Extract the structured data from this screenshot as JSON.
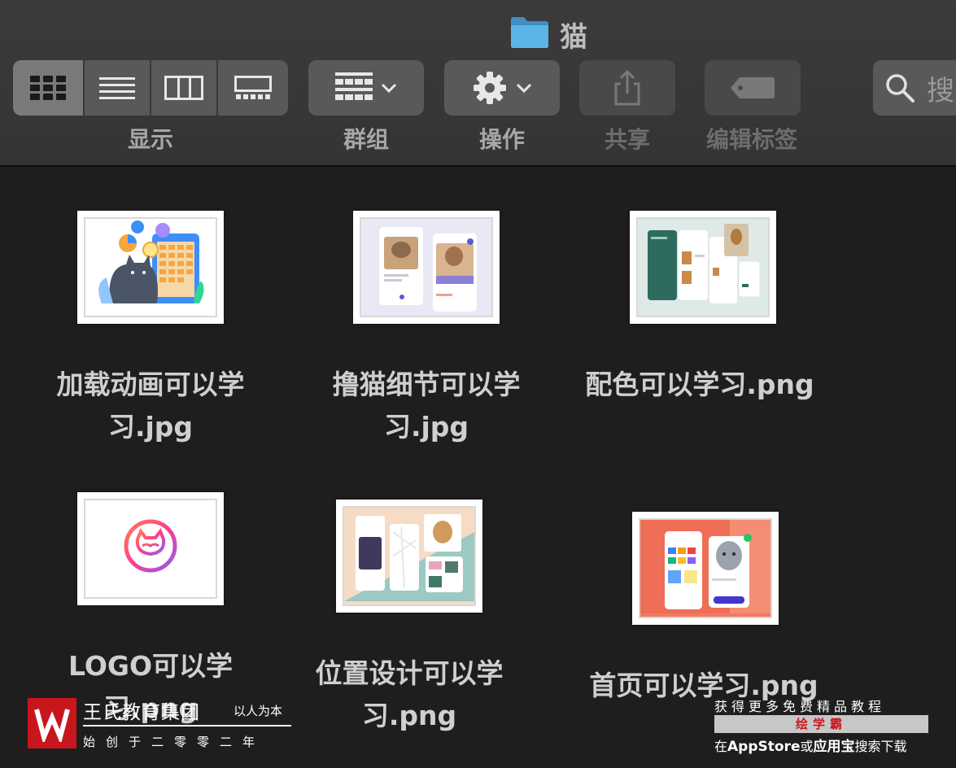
{
  "window": {
    "title": "猫"
  },
  "toolbar": {
    "view_label": "显示",
    "group_label": "群组",
    "action_label": "操作",
    "share_label": "共享",
    "tags_label": "编辑标签",
    "search_placeholder": "搜"
  },
  "files": [
    {
      "name_line1": "加载动画可以学",
      "name_line2": "习.jpg"
    },
    {
      "name_line1": "撸猫细节可以学",
      "name_line2": "习.jpg"
    },
    {
      "name_line1": "配色可以学习.png",
      "name_line2": ""
    },
    {
      "name_line1": "LOGO可以学",
      "name_line2": "习.png"
    },
    {
      "name_line1": "位置设计可以学",
      "name_line2": "习.png"
    },
    {
      "name_line1": "首页可以学习.png",
      "name_line2": ""
    }
  ],
  "watermark_left": {
    "company": "王氏教育集团",
    "slogan": "以人为本",
    "founded": "始创于二零零二年"
  },
  "watermark_right": {
    "line1": "获得更多免费精品教程",
    "brand": "绘学霸",
    "line3_pre": "在",
    "line3_store": "AppStore",
    "line3_mid": "或",
    "line3_app": "应用宝",
    "line3_post": "搜索下载"
  },
  "colors": {
    "toolbar_bg": "#3c3a3b",
    "content_bg": "#1f1d1e",
    "folder_blue": "#4aa6d9",
    "brand_red": "#c8161d"
  }
}
